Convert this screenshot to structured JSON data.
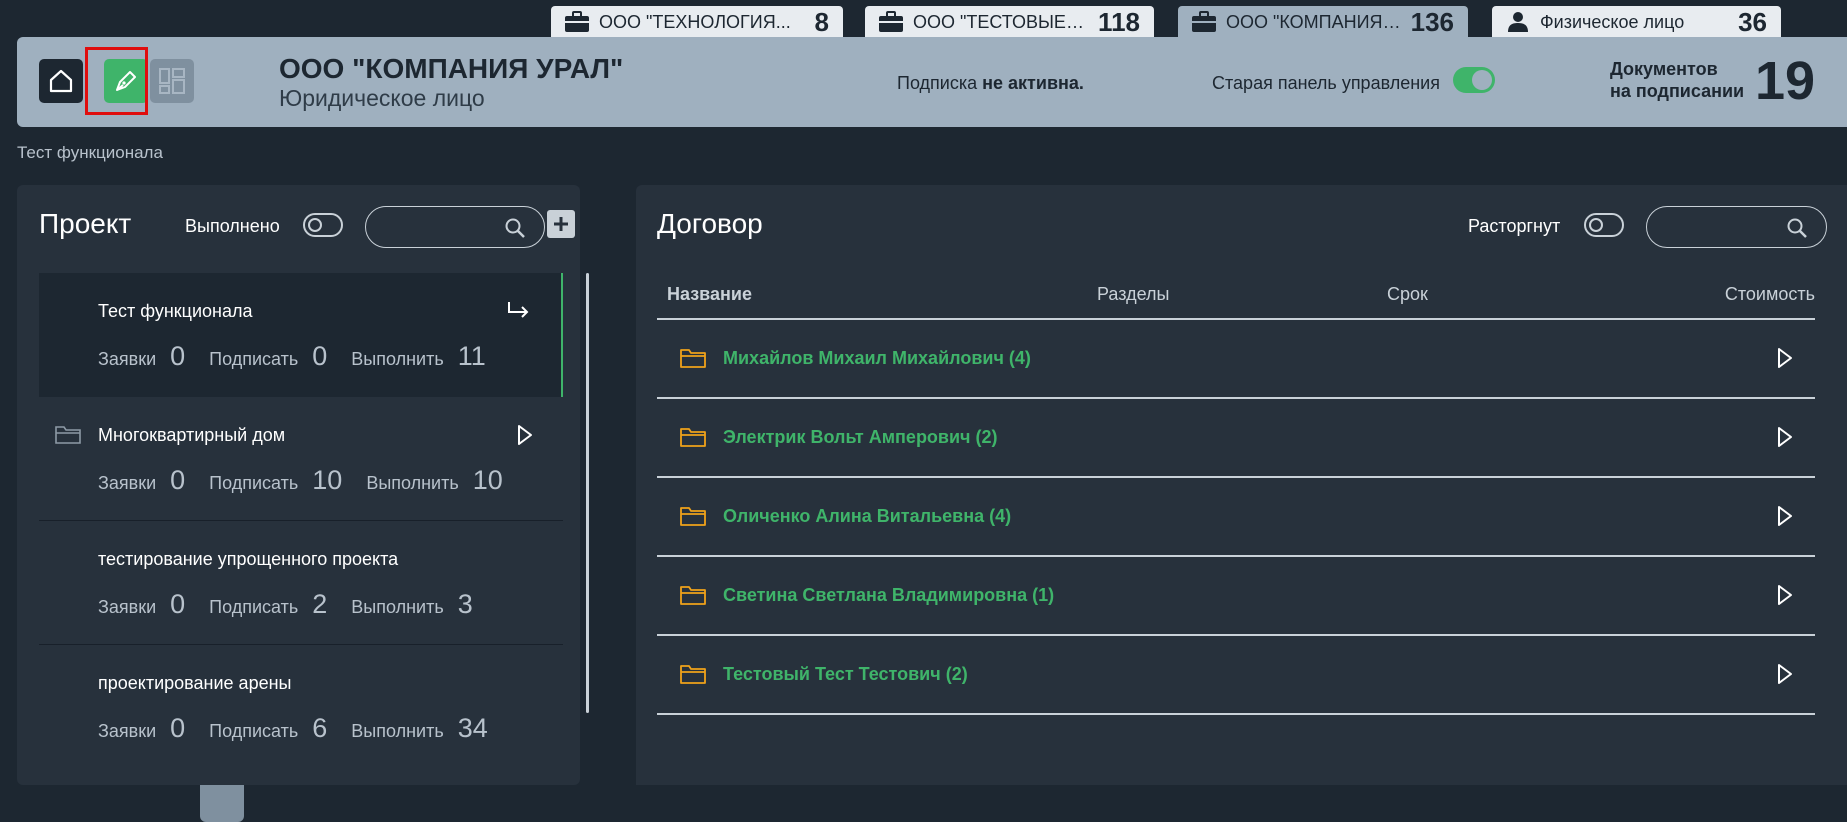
{
  "tabs": [
    {
      "name": "ООО \"ТЕХНОЛОГИЯ...",
      "count": "8",
      "icon": "briefcase-icon"
    },
    {
      "name": "ООО \"ТЕСТОВЫЕ Р...",
      "count": "118",
      "icon": "briefcase-icon"
    },
    {
      "name": "ООО \"КОМПАНИЯ У...",
      "count": "136",
      "icon": "briefcase-icon"
    },
    {
      "name": "Физическое лицо",
      "count": "36",
      "icon": "person-icon"
    }
  ],
  "header": {
    "company_name": "ООО \"КОМПАНИЯ УРАЛ\"",
    "company_type": "Юридическое лицо",
    "subscription_prefix": "Подписка",
    "subscription_status": "не активна.",
    "old_panel_label": "Старая панель управления",
    "docs_label_line1": "Документов",
    "docs_label_line2": "на подписании",
    "docs_count": "19",
    "accent_color": "#3fb46a",
    "highlight_color": "#e00d0d"
  },
  "breadcrumb": "Тест функционала",
  "project_panel": {
    "title": "Проект",
    "done_label": "Выполнено",
    "search_placeholder": "",
    "items": [
      {
        "name": "Тест функционала",
        "requests_label": "Заявки",
        "requests": "0",
        "sign_label": "Подписать",
        "sign": "0",
        "do_label": "Выполнить",
        "do": "11"
      },
      {
        "name": "Многоквартирный дом",
        "requests_label": "Заявки",
        "requests": "0",
        "sign_label": "Подписать",
        "sign": "10",
        "do_label": "Выполнить",
        "do": "10"
      },
      {
        "name": "тестирование упрощенного проекта",
        "requests_label": "Заявки",
        "requests": "0",
        "sign_label": "Подписать",
        "sign": "2",
        "do_label": "Выполнить",
        "do": "3"
      },
      {
        "name": "проектирование арены",
        "requests_label": "Заявки",
        "requests": "0",
        "sign_label": "Подписать",
        "sign": "6",
        "do_label": "Выполнить",
        "do": "34"
      }
    ]
  },
  "contract_panel": {
    "title": "Договор",
    "terminated_label": "Расторгнут",
    "search_placeholder": "",
    "columns": [
      "Название",
      "Разделы",
      "Срок",
      "Стоимость"
    ],
    "rows": [
      "Михайлов Михаил Михайлович (4)",
      "Электрик Вольт Амперович (2)",
      "Оличенко Алина Витальевна (4)",
      "Светина Светлана Владимировна (1)",
      "Тестовый Тест Тестович (2)"
    ]
  }
}
